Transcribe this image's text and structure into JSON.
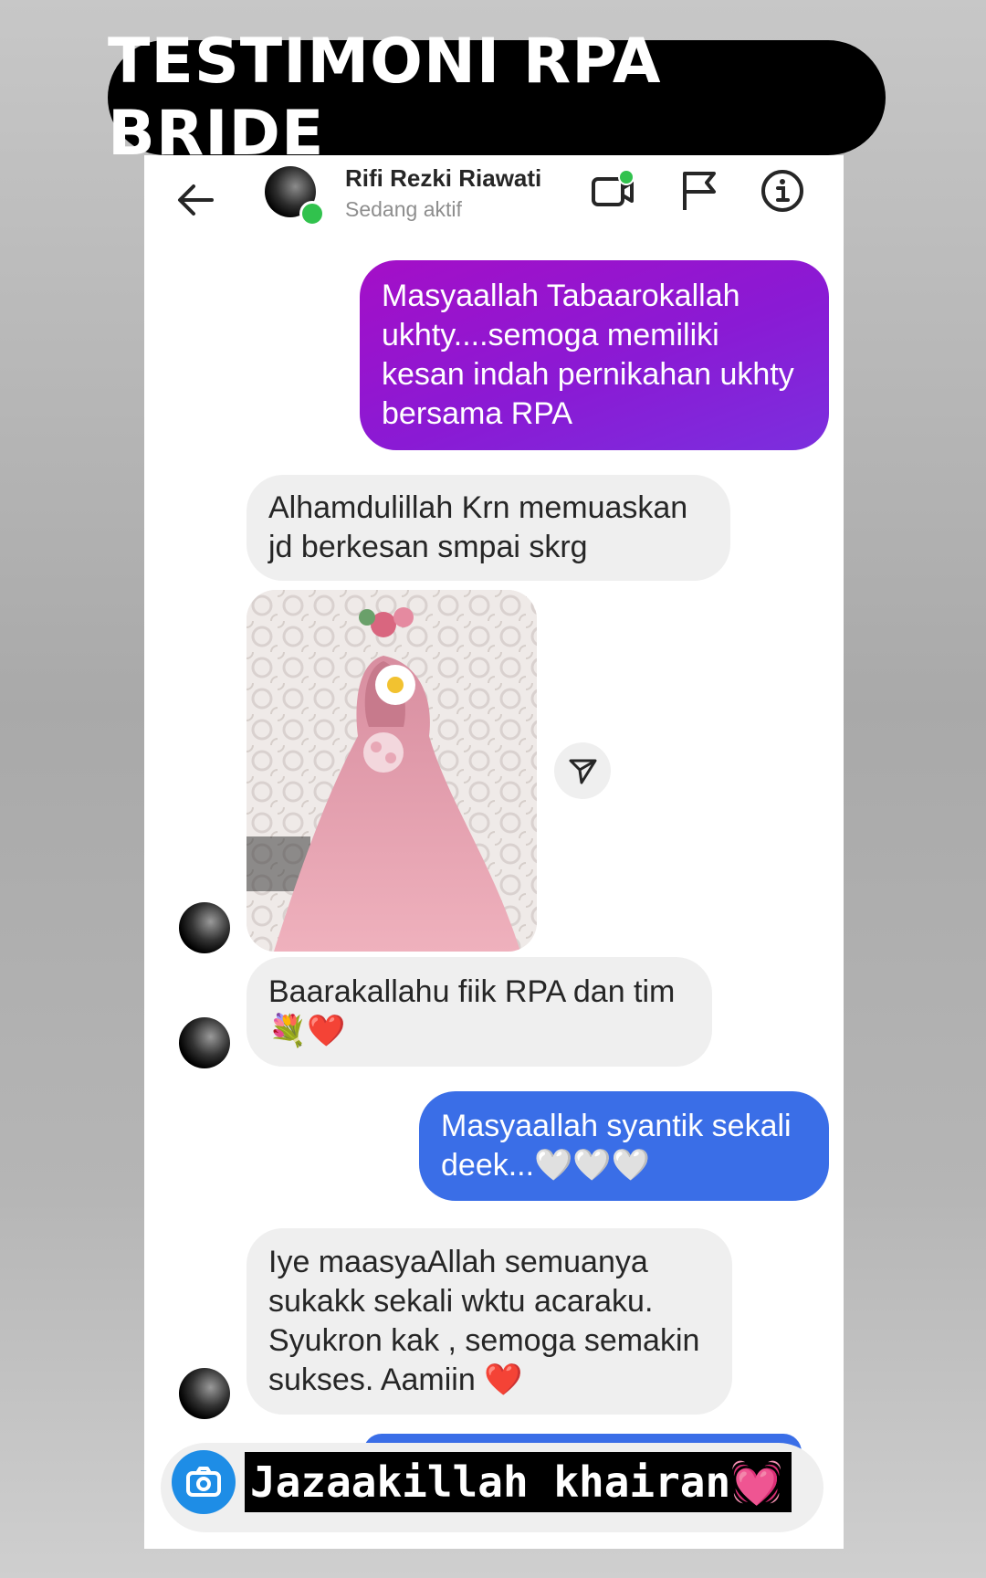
{
  "banner": {
    "title": "TESTIMONI RPA BRIDE"
  },
  "header": {
    "contact_name": "Rifi Rezki Riawati",
    "contact_status": "Sedang aktif",
    "icons": [
      "back-arrow-icon",
      "video-call-icon",
      "flag-icon",
      "info-icon"
    ]
  },
  "messages": [
    {
      "from": "me",
      "text": "Masyaallah Tabaarokallah ukhty....semoga memiliki kesan indah pernikahan ukhty bersama RPA"
    },
    {
      "from": "them",
      "text": "Alhamdulillah Krn memuaskan jd berkesan smpai skrg"
    },
    {
      "from": "them",
      "type": "photo"
    },
    {
      "from": "them",
      "text": "Baarakallahu fiik RPA dan tim",
      "emoji": "💐❤️"
    },
    {
      "from": "me",
      "text": "Masyaallah syantik sekali deek...",
      "emoji": "🤍🤍🤍"
    },
    {
      "from": "them",
      "text": "Iye maasyaAllah semuanya sukakk sekali wktu acaraku. Syukron kak , semoga semakin sukses. Aamiin",
      "emoji": "❤️"
    }
  ],
  "caption": {
    "text": "Jazaakillah khairan",
    "emoji": "💓"
  },
  "colors": {
    "outgoing_gradient_start": "#a40fc7",
    "outgoing_gradient_end": "#7b2fde",
    "outgoing_blue": "#3a6ee7",
    "incoming_grey": "#efefef",
    "online_green": "#31c24d",
    "camera_blue": "#1e8de6"
  }
}
